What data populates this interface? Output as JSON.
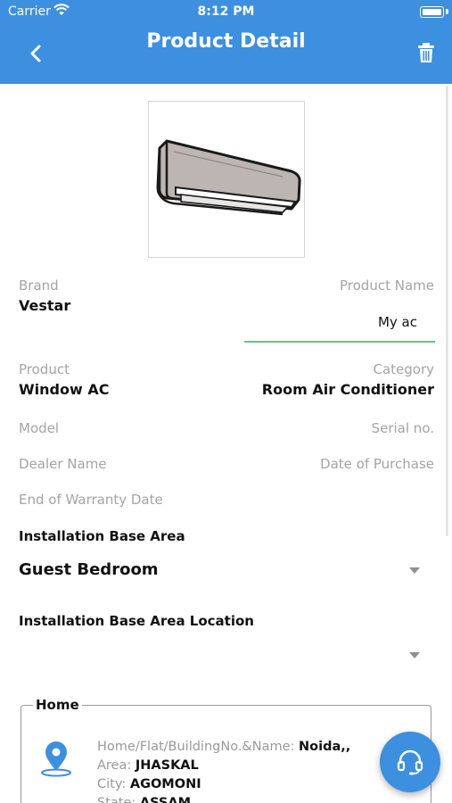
{
  "status_bar": {
    "carrier": "Carrier",
    "time": "8:12 PM",
    "battery_level": 1.0
  },
  "header": {
    "title": "Product Detail",
    "back_icon": "chevron-left-icon",
    "delete_icon": "trash-icon"
  },
  "product": {
    "image_icon": "air-conditioner-image",
    "brand_label": "Brand",
    "brand_value": "Vestar",
    "name_label": "Product Name",
    "name_value": "My ac",
    "product_label": "Product",
    "product_value": "Window AC",
    "category_label": "Category",
    "category_value": "Room Air Conditioner",
    "model_label": "Model",
    "serial_label": "Serial no.",
    "dealer_label": "Dealer Name",
    "purchase_label": "Date of Purchase",
    "warranty_label": "End of Warranty Date"
  },
  "installation": {
    "area_label": "Installation Base Area",
    "area_value": "Guest Bedroom",
    "location_label": "Installation Base Area Location",
    "location_value": ""
  },
  "address": {
    "legend": "Home",
    "icon": "location-pin-icon",
    "line1_label": "Home/Flat/BuildingNo.&Name:",
    "line1_value": "Noida,,",
    "area_label": "Area:",
    "area_value": "JHASKAL",
    "city_label": "City:",
    "city_value": "AGOMONI",
    "state_label": "State:",
    "state_value": "ASSAM"
  },
  "support": {
    "icon": "headset-icon"
  },
  "colors": {
    "primary": "#3d8fe0",
    "input_underline": "#5cc88a",
    "label_gray": "#a4a4a4"
  }
}
